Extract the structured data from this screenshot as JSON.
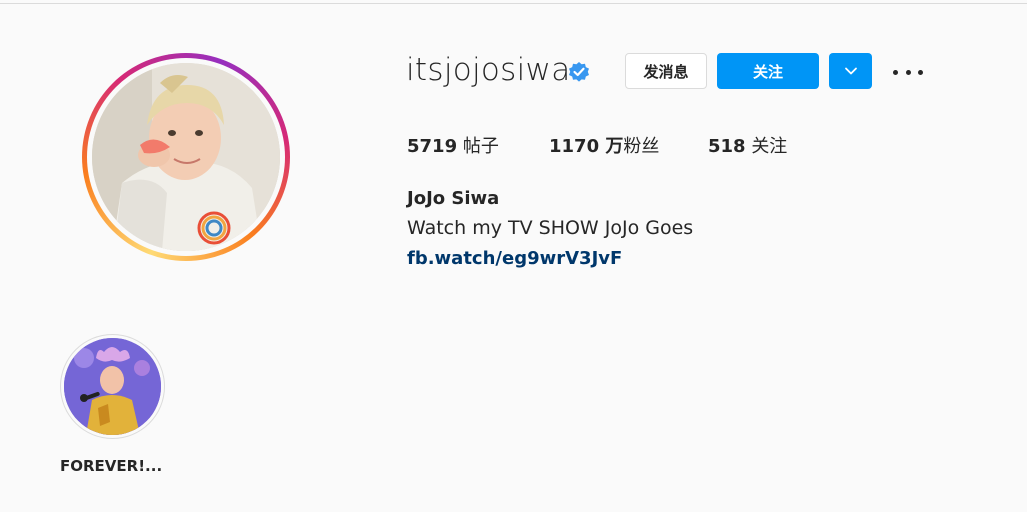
{
  "profile": {
    "username": "itsjojosiwa",
    "verified": true,
    "full_name": "JoJo Siwa",
    "bio": "Watch my TV SHOW JoJo Goes",
    "link": "fb.watch/eg9wrV3JvF"
  },
  "actions": {
    "message_label": "发消息",
    "follow_label": "关注",
    "dropdown_icon": "chevron-down-icon",
    "more_icon": "more-options-icon"
  },
  "stats": {
    "posts_count": "5719",
    "posts_label": "帖子",
    "followers_count": "1170 万",
    "followers_label": "粉丝",
    "following_count": "518",
    "following_label": "关注"
  },
  "highlights": [
    {
      "label": "FOREVER!..."
    }
  ],
  "colors": {
    "follow_blue": "#0095f6",
    "link_blue": "#00376b",
    "verified_blue": "#3897f0"
  }
}
